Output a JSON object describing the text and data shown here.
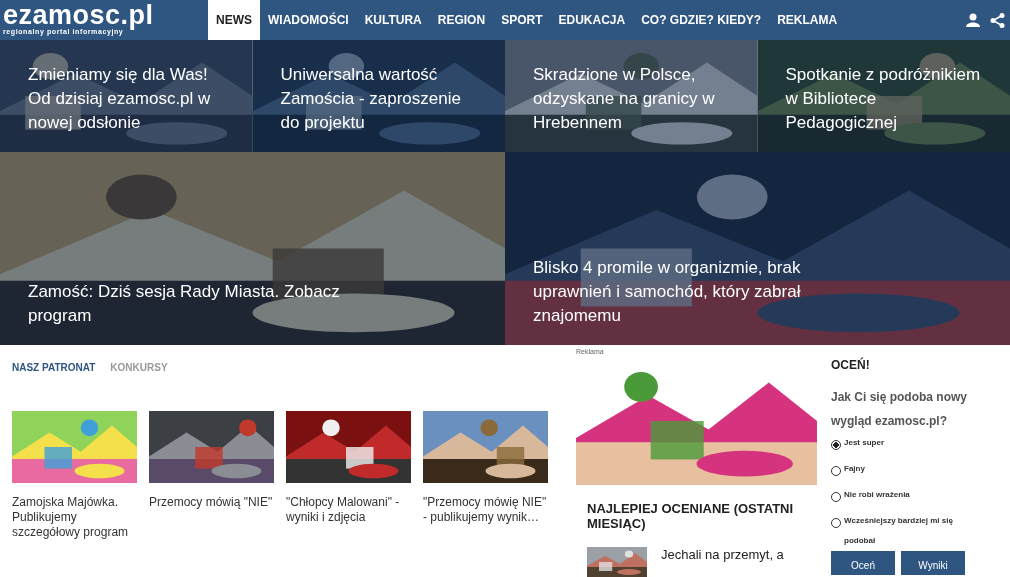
{
  "header": {
    "logo": "ezamosc.pl",
    "tagline": "regionalny portal informacyjny",
    "nav": [
      {
        "label": "NEWS",
        "selected": true
      },
      {
        "label": "WIADOMOŚCI",
        "selected": false
      },
      {
        "label": "KULTURA",
        "selected": false
      },
      {
        "label": "REGION",
        "selected": false
      },
      {
        "label": "SPORT",
        "selected": false
      },
      {
        "label": "EDUKACJA",
        "selected": false
      },
      {
        "label": "CO? GDZIE? KIEDY?",
        "selected": false
      },
      {
        "label": "REKLAMA",
        "selected": false
      }
    ]
  },
  "top_stories": [
    {
      "title": "Zmieniamy się dla Was! Od dzisiaj ezamosc.pl w nowej odsłonie"
    },
    {
      "title": "Uniwersalna wartość Zamościa - zaproszenie do projektu"
    },
    {
      "title": "Skradzione w Polsce, odzyskane na granicy w Hrebennem"
    },
    {
      "title": "Spotkanie z podróżnikiem w Bibliotece Pedagogicznej"
    }
  ],
  "main_stories": [
    {
      "title": "Zamość: Dziś sesja Rady Miasta. Zobacz program"
    },
    {
      "title": "Blisko 4 promile w organizmie, brak uprawnień i samochód, który zabrał znajomemu"
    }
  ],
  "section_tabs": [
    {
      "label": "NASZ PATRONAT",
      "selected": true
    },
    {
      "label": "KONKURSY",
      "selected": false
    }
  ],
  "patronage": [
    {
      "title": "Zamojska Majówka. Publikujemy szczegółowy program"
    },
    {
      "title": "Przemocy mówią \"NIE\""
    },
    {
      "title": "\"Chłopcy Malowani\" - wyniki i zdjęcia"
    },
    {
      "title": "\"Przemocy mówię NIE\" - publikujemy wynik…"
    }
  ],
  "ad": {
    "label": "Reklama",
    "kind": "picture"
  },
  "top_rated": {
    "heading": "NAJLEPIEJ OCENIANE (OSTATNI MIESIĄC)",
    "items": [
      {
        "title": "Jechali na przemyt, a"
      }
    ]
  },
  "poll": {
    "heading": "OCEŃ!",
    "question": "Jak Ci się podoba nowy wygląd ezamosc.pl?",
    "options": [
      {
        "label": "Jest super",
        "selected": true
      },
      {
        "label": "Fajny",
        "selected": false
      },
      {
        "label": "Nie robi wrażenia",
        "selected": false
      },
      {
        "label": "Wcześniejszy bardziej mi się podobał",
        "selected": false
      }
    ],
    "buttons": [
      "Oceń",
      "Wyniki"
    ]
  }
}
